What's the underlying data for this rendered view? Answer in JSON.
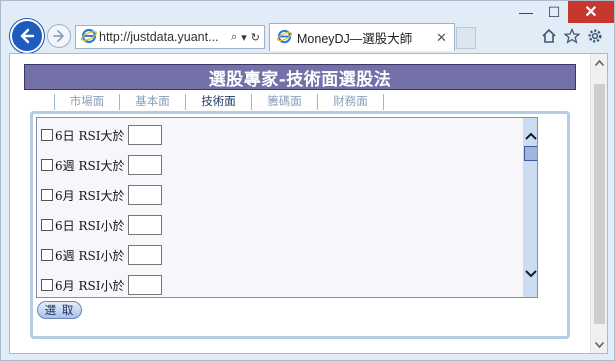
{
  "browser": {
    "address_url": "http://justdata.yuant...",
    "tab_title": "MoneyDJ—選股大師",
    "min_glyph": "—",
    "max_glyph": "☐",
    "close_glyph": "✕",
    "search_glyph": "⌕",
    "dropdown_glyph": "▾",
    "refresh_glyph": "↻",
    "tab_close_glyph": "✕"
  },
  "page": {
    "title": "選股專家-技術面選股法",
    "tabs": [
      {
        "label": "市場面",
        "active": false
      },
      {
        "label": "基本面",
        "active": false
      },
      {
        "label": "技術面",
        "active": true
      },
      {
        "label": "籌碼面",
        "active": false
      },
      {
        "label": "財務面",
        "active": false
      }
    ],
    "criteria": [
      {
        "label": "6日 RSI大於",
        "value": ""
      },
      {
        "label": "6週 RSI大於",
        "value": ""
      },
      {
        "label": "6月 RSI大於",
        "value": ""
      },
      {
        "label": "6日 RSI小於",
        "value": ""
      },
      {
        "label": "6週 RSI小於",
        "value": ""
      },
      {
        "label": "6月 RSI小於",
        "value": ""
      }
    ],
    "select_button": "選 取"
  },
  "colors": {
    "title_bar": "#7471a9",
    "panel_border": "#b6cbe6",
    "browser_back": "#1e5bbf",
    "close_button": "#c7372d"
  }
}
